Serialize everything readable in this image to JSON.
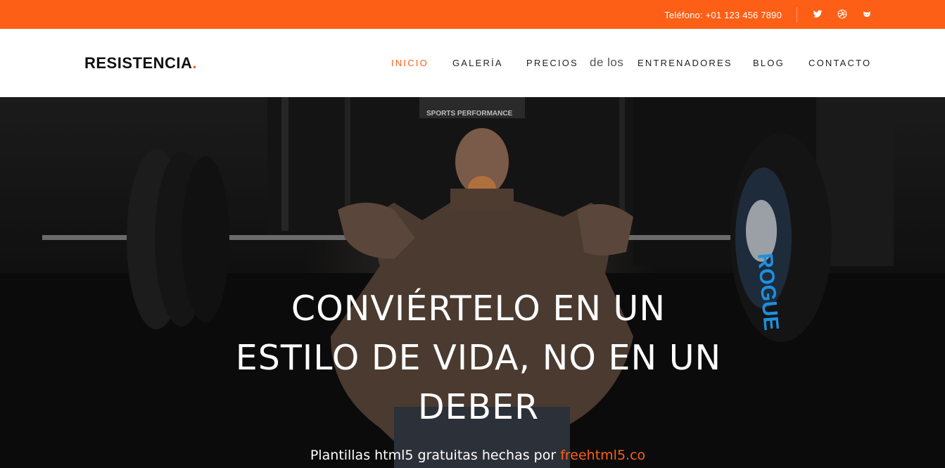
{
  "topbar": {
    "phone": "Teléfono: +01 123 456 7890",
    "social": [
      {
        "icon": "twitter-icon"
      },
      {
        "icon": "dribbble-icon"
      },
      {
        "icon": "github-icon"
      }
    ],
    "color": "#fe5f16"
  },
  "header": {
    "logo_text": "RESISTENCIA",
    "logo_dot": ".",
    "nav": {
      "inicio": "INICIO",
      "galeria": "GALERÍA",
      "precios": "PRECIOS",
      "de_los": "de los",
      "entrenadores": "ENTRENADORES",
      "blog": "BLOG",
      "contacto": "CONTACTO"
    },
    "active_item": "INICIO"
  },
  "hero": {
    "title": "CONVIÉRTELO EN UN ESTILO DE VIDA, NO EN UN DEBER",
    "credit_prefix": "Plantillas html5 gratuitas hechas por",
    "credit_link": "freehtml5.co",
    "sign_text": "SPORTS PERFORMANCE",
    "plate_text": "ROGUE"
  },
  "colors": {
    "accent": "#fe5f16",
    "text_dark": "#222222"
  }
}
